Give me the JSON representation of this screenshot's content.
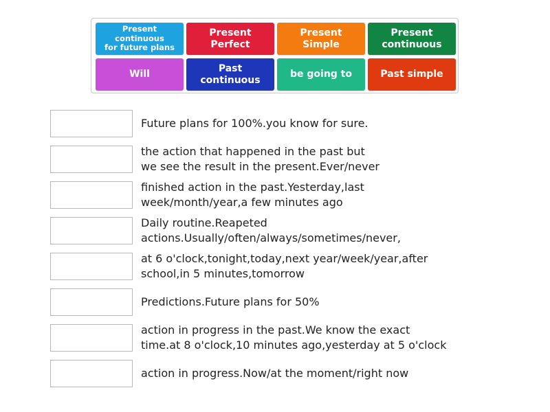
{
  "tiles": [
    {
      "label": "Present continuous\nfor future plans",
      "color": "#1fa3e0"
    },
    {
      "label": "Present\nPerfect",
      "color": "#e0203a"
    },
    {
      "label": "Present\nSimple",
      "color": "#f47b10"
    },
    {
      "label": "Present\ncontinuous",
      "color": "#128542"
    },
    {
      "label": "Will",
      "color": "#c84fd8"
    },
    {
      "label": "Past\ncontinuous",
      "color": "#1e36b8"
    },
    {
      "label": "be going to",
      "color": "#1fb886"
    },
    {
      "label": "Past simple",
      "color": "#e03a10"
    }
  ],
  "rows": [
    {
      "text": "Future plans for 100%.you know for sure."
    },
    {
      "text": "the action that happened in the past but\nwe see the result in the present.Ever/never"
    },
    {
      "text": "finished action in the past.Yesterday,last\nweek/month/year,a few minutes ago"
    },
    {
      "text": "Daily routine.Reapeted\nactions.Usually/often/always/sometimes/never,"
    },
    {
      "text": "at 6 o'clock,tonight,today,next year/week/year,after\nschool,in 5 minutes,tomorrow"
    },
    {
      "text": "Predictions.Future plans for 50%"
    },
    {
      "text": "action in progress in the past.We know the exact\ntime.at 8 o'clock,10 minutes ago,yesterday at 5 o'clock"
    },
    {
      "text": "action in progress.Now/at the moment/right now"
    }
  ]
}
